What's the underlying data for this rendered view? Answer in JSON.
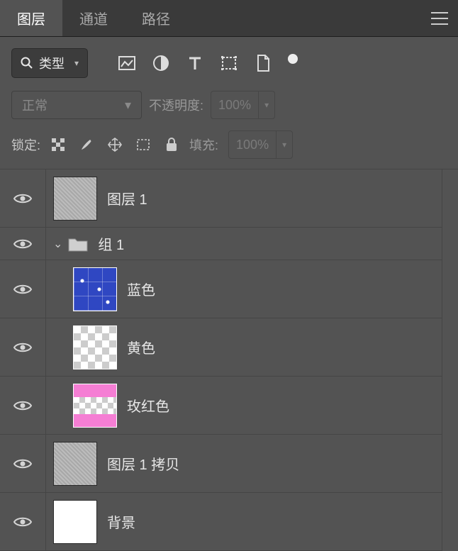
{
  "tabs": {
    "layers": "图层",
    "channels": "通道",
    "paths": "路径"
  },
  "filter": {
    "type_label": "类型"
  },
  "blend": {
    "mode": "正常",
    "opacity_label": "不透明度:",
    "opacity_value": "100%"
  },
  "lock": {
    "label": "锁定:",
    "fill_label": "填充:",
    "fill_value": "100%"
  },
  "layers": {
    "layer1": "图层 1",
    "group1": "组 1",
    "blue": "蓝色",
    "yellow": "黄色",
    "rose": "玫红色",
    "layer1copy": "图层 1 拷贝",
    "background": "背景"
  }
}
